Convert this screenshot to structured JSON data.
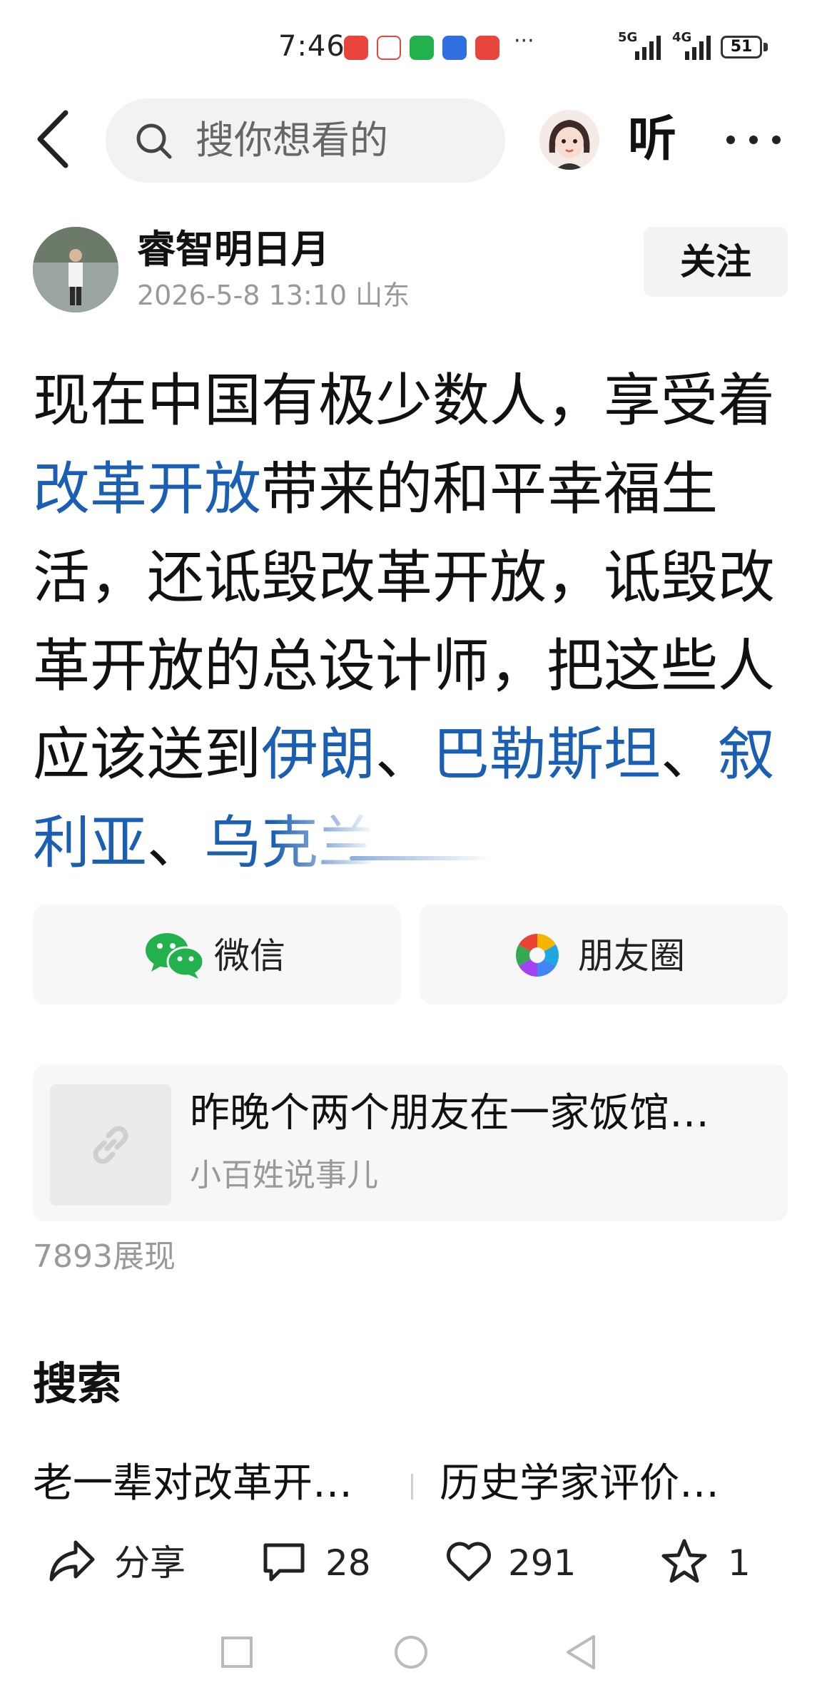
{
  "status_bar": {
    "time": "7:46",
    "network1": "5G",
    "network2": "4G",
    "battery": "51",
    "more": "···"
  },
  "nav": {
    "search_placeholder": "搜你想看的",
    "listen_label": "听"
  },
  "author": {
    "name": "睿智明日月",
    "meta": "2026-5-8 13:10 山东",
    "follow_label": "关注"
  },
  "article": {
    "seg1": "现在中国有极少数人，享受着",
    "link1": "改革开放",
    "seg2": "带来的和平幸福生活，还诋毁改革开放，诋毁改革开放的总设计师，把这些人应该送到",
    "link2": "伊朗",
    "sep1": "、",
    "link3": "巴勒斯坦",
    "sep2": "、",
    "link4": "叙利亚",
    "sep3": "、",
    "link5": "乌克兰"
  },
  "share": {
    "wechat_label": "微信",
    "moments_label": "朋友圈"
  },
  "link_card": {
    "title": "昨晚个两个朋友在一家饭馆…",
    "source": "小百姓说事儿"
  },
  "impressions": "7893展现",
  "search_section": {
    "title": "搜索",
    "items": [
      "老一辈对改革开…",
      "历史学家评价…"
    ]
  },
  "actions": {
    "share_label": "分享",
    "comments": "28",
    "likes": "291",
    "favorites": "1"
  },
  "colors": {
    "link": "#1a5fb4",
    "wechat": "#22b14c"
  }
}
